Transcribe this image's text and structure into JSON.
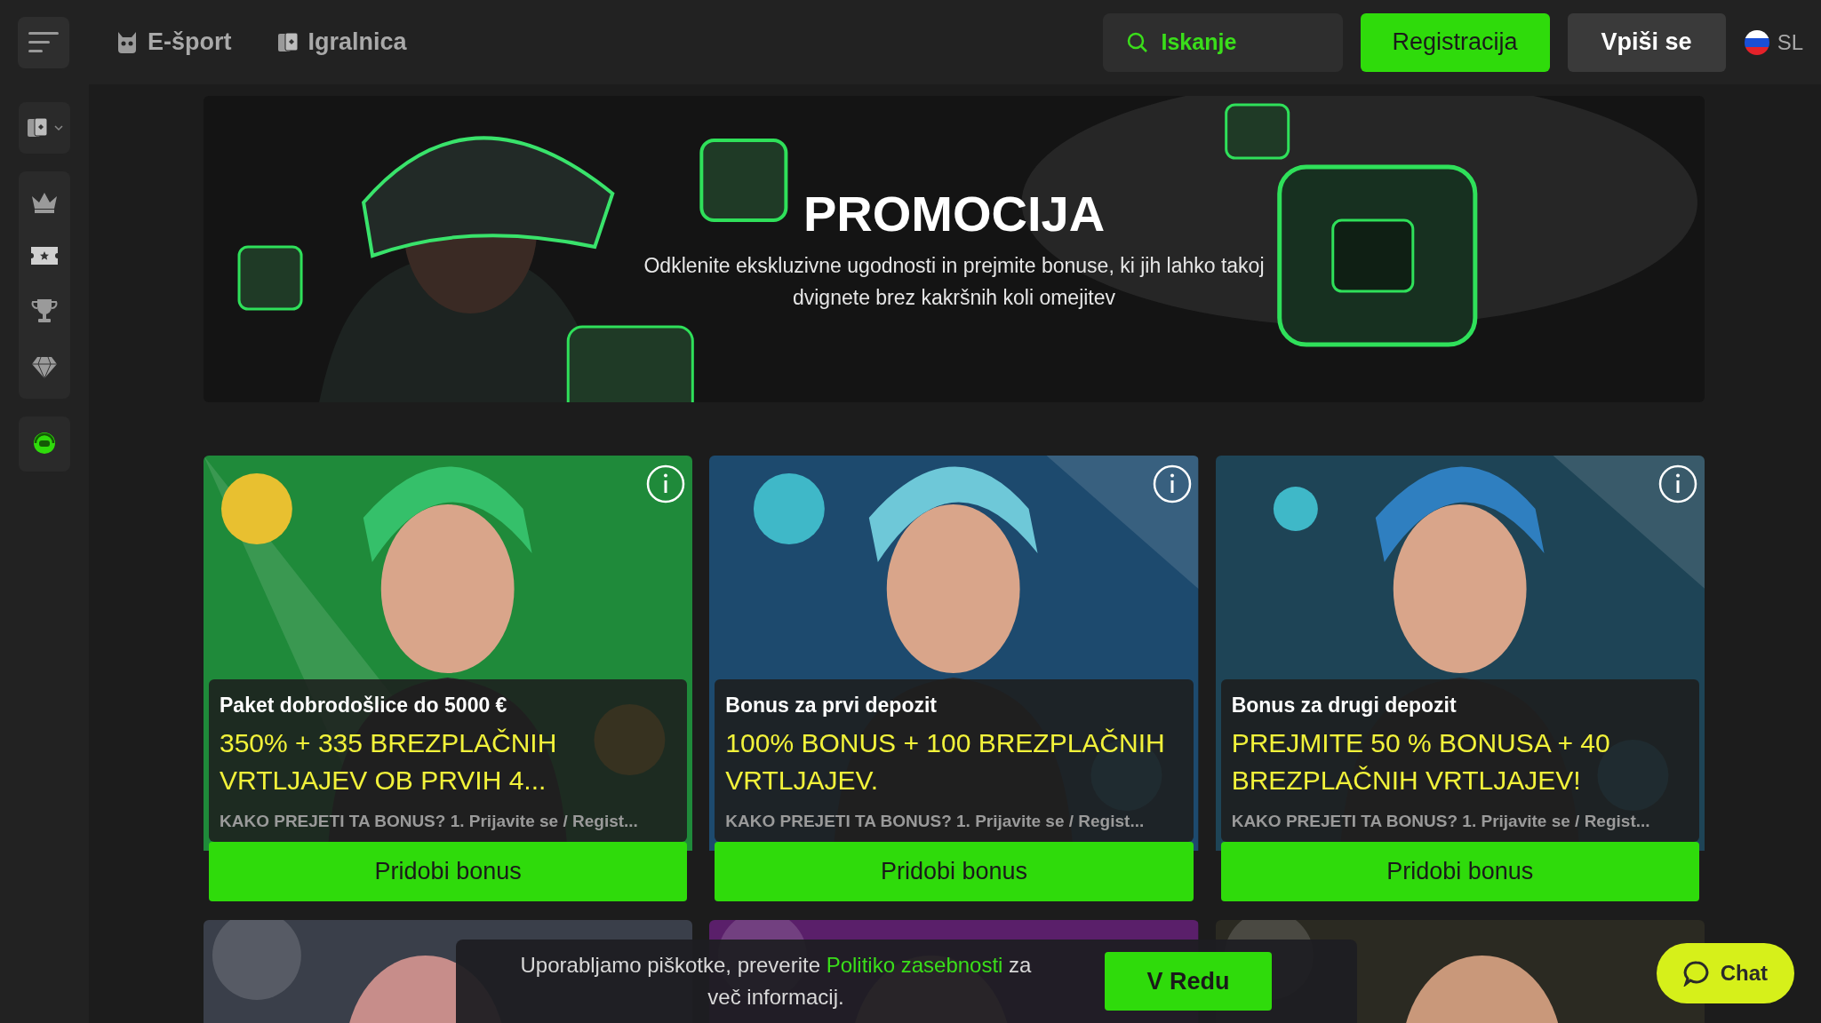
{
  "topbar": {
    "nav": [
      {
        "kind": "esport",
        "label": "E-šport"
      },
      {
        "kind": "casino",
        "label": "Igralnica"
      }
    ],
    "search": {
      "placeholder": "Iskanje"
    },
    "register": "Registracija",
    "login": "Vpiši se",
    "language": "SL"
  },
  "banner": {
    "title": "PROMOCIJA",
    "text": "Odklenite ekskluzivne ugodnosti in prejmite bonuse, ki jih lahko takoj dvignete brez kakršnih koli omejitev"
  },
  "promos": [
    {
      "title": "Paket dobrodošlice do 5000 €",
      "headline": "350% + 335 BREZPLAČNIH VRTLJAJEV OB PRVIH 4...",
      "description": "KAKO PREJETI TA BONUS? 1. Prijavite se / Regist...",
      "button": "Pridobi bonus"
    },
    {
      "title": "Bonus za prvi depozit",
      "headline": "100% BONUS + 100 BREZPLAČNIH VRTLJAJEV.",
      "description": "KAKO PREJETI TA BONUS? 1. Prijavite se / Regist...",
      "button": "Pridobi bonus"
    },
    {
      "title": "Bonus za drugi depozit",
      "headline": "PREJMITE 50 % BONUSA + 40 BREZPLAČNIH VRTLJAJEV!",
      "description": "KAKO PREJETI TA BONUS? 1. Prijavite se / Regist...",
      "button": "Pridobi bonus"
    }
  ],
  "cookie": {
    "before": "Uporabljamo piškotke, preverite ",
    "link": "Politiko zasebnosti",
    "after": " za več informacij.",
    "button": "V Redu"
  },
  "chat": {
    "label": "Chat"
  }
}
